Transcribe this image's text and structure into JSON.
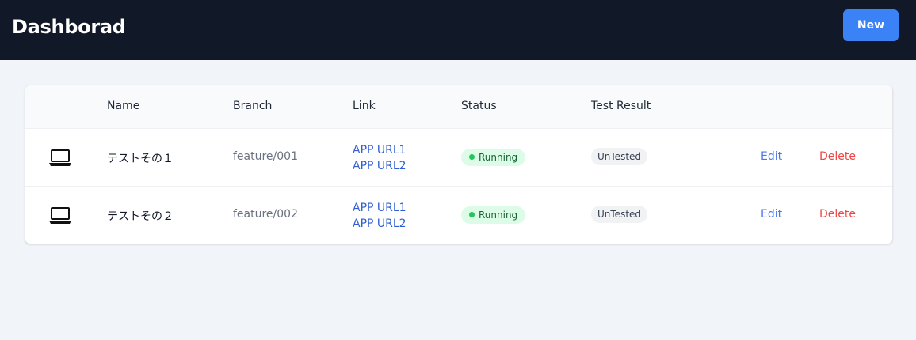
{
  "header": {
    "title": "Dashborad",
    "new_label": "New"
  },
  "table": {
    "columns": [
      "",
      "Name",
      "Branch",
      "Link",
      "Status",
      "Test Result",
      "",
      ""
    ],
    "rows": [
      {
        "icon": "laptop-icon",
        "name": "テストその１",
        "branch": "feature/001",
        "links": [
          "APP URL1",
          "APP URL2"
        ],
        "status": "Running",
        "test_result": "UnTested",
        "edit": "Edit",
        "delete": "Delete"
      },
      {
        "icon": "laptop-icon",
        "name": "テストその２",
        "branch": "feature/002",
        "links": [
          "APP URL1",
          "APP URL2"
        ],
        "status": "Running",
        "test_result": "UnTested",
        "edit": "Edit",
        "delete": "Delete"
      }
    ]
  },
  "colors": {
    "header_bg": "#111827",
    "accent": "#3b82f6",
    "status_running_bg": "#dcfce7",
    "status_running_dot": "#22c55e",
    "delete": "#ef4444",
    "link": "#2f5fd1"
  }
}
